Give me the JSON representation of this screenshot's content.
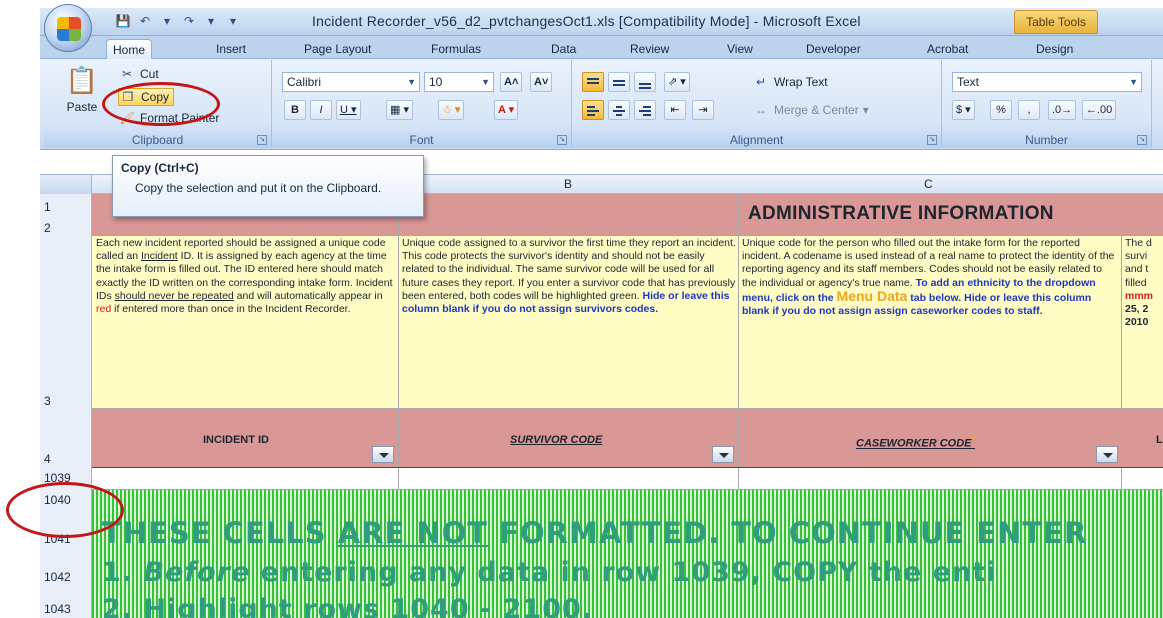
{
  "window": {
    "title": "Incident Recorder_v56_d2_pvtchangesOct1.xls  [Compatibility Mode] - Microsoft Excel",
    "context_tab": "Table Tools"
  },
  "tabs": [
    "Home",
    "Insert",
    "Page Layout",
    "Formulas",
    "Data",
    "Review",
    "View",
    "Developer",
    "Acrobat",
    "Design"
  ],
  "ribbon": {
    "clipboard": {
      "label": "Clipboard",
      "paste": "Paste",
      "cut": "Cut",
      "copy": "Copy",
      "format_painter": "Format Painter"
    },
    "font": {
      "label": "Font",
      "name": "Calibri",
      "size": "10"
    },
    "alignment": {
      "label": "Alignment",
      "wrap_text": "Wrap Text",
      "merge_center": "Merge & Center"
    },
    "number": {
      "label": "Number",
      "format": "Text"
    }
  },
  "tooltip": {
    "title": "Copy (Ctrl+C)",
    "description": "Copy the selection and put it on the Clipboard."
  },
  "sheet": {
    "columns": [
      "B",
      "C"
    ],
    "rows": [
      "1",
      "2",
      "3",
      "4",
      "1039",
      "1040",
      "1041",
      "1042",
      "1043"
    ],
    "admin_title": "ADMINISTRATIVE INFORMATION",
    "desc_a": {
      "p1": "Each new incident reported should be assigned a unique code called an ",
      "p1_u": "Incident",
      "p2": " ID. It is assigned by each agency at the time the intake form is filled out. The ID entered here should match exactly the ID written on the corresponding intake  form. Incident IDs ",
      "p2_u": "should never be repeated",
      "p3": " and will automatically appear in ",
      "p3_red": "red",
      "p4": " if entered more than once in the Incident Recorder."
    },
    "desc_b": {
      "p1": "Unique code assigned to a survivor the first time they report an incident.  This code protects the survivor's identity and should not be easily related to the individual. The same survivor code will be used for all future cases they report.  If you enter a survivor code that has previously been entered, both codes will be highlighted green.  ",
      "blue": "Hide or leave this column blank if you do not assign survivors codes."
    },
    "desc_c": {
      "p1": "Unique code for the person who filled out the intake form for the reported incident. A codename is used instead of a real name to protect the identity of the reporting agency and its staff members.  Codes should not be easily related to the individual or agency's true name.  ",
      "blue1": "To add an ethnicity to the dropdown menu, click on the ",
      "menu": "Menu Data",
      "blue2": " tab below. Hide or leave this column blank if you do not assign assign caseworker codes to staff."
    },
    "desc_d": [
      "The d",
      "survi",
      "and t",
      "filled",
      "mmm",
      "25, 2",
      "2010"
    ],
    "headers": {
      "incident": "INCIDENT ID",
      "survivor": "SURVIVOR CODE",
      "caseworker": "CASEWORKER CODE",
      "caseworker_mark": "*",
      "next": "L"
    },
    "notice": {
      "line1_a": "THESE CELLS ",
      "line1_u": "ARE NOT",
      "line1_b": " FORMATTED. TO CONTINUE ENTER",
      "line2_a": "1. ",
      "line2_i": "Before",
      "line2_b": " entering any data in row 1039, COPY the enti",
      "line3": "2. Highlight rows 1040 - 2100."
    }
  }
}
